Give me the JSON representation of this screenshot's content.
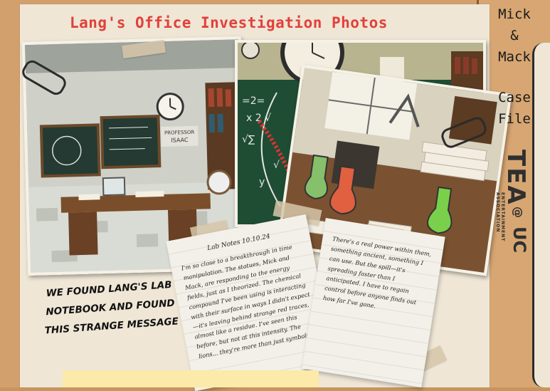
{
  "page": {
    "title": "Lang's Office Investigation Photos"
  },
  "side_labels": {
    "line1": "Mick",
    "line2": "&",
    "line3": "Mack",
    "line4": "Case",
    "line5": "File"
  },
  "brand": {
    "logo_text": "TEA",
    "circle": "@",
    "suffix": "UC",
    "small_text": "ENTERTAINMENT ASSOCIATION"
  },
  "photo_a": {
    "sign_line1": "PROFESSOR",
    "sign_line2": "ISAAC"
  },
  "caption": {
    "line1": "We found Lang's lab",
    "line2": "notebook and found",
    "line3": "this strange message"
  },
  "note1": {
    "heading": "Lab Notes 10.10.24",
    "body": "I'm so close to a breakthrough in time manipulation. The statues, Mick and Mack, are responding to the energy fields, just as I theorized. The chemical compound I've been using is interacting with their surface in ways I didn't expect—it's leaving behind strange red traces, almost like a residue. I've seen this before, but not at this intensity. The lions... they're more than just symbols."
  },
  "note2": {
    "body": "There's a real power within them, something ancient, something I can use. But the spill—it's spreading faster than I anticipated. I have to regain control before anyone finds out how far I've gone."
  },
  "colors": {
    "title_red": "#e2403a",
    "folder": "#d2a06d",
    "paper": "#efe6d6"
  }
}
